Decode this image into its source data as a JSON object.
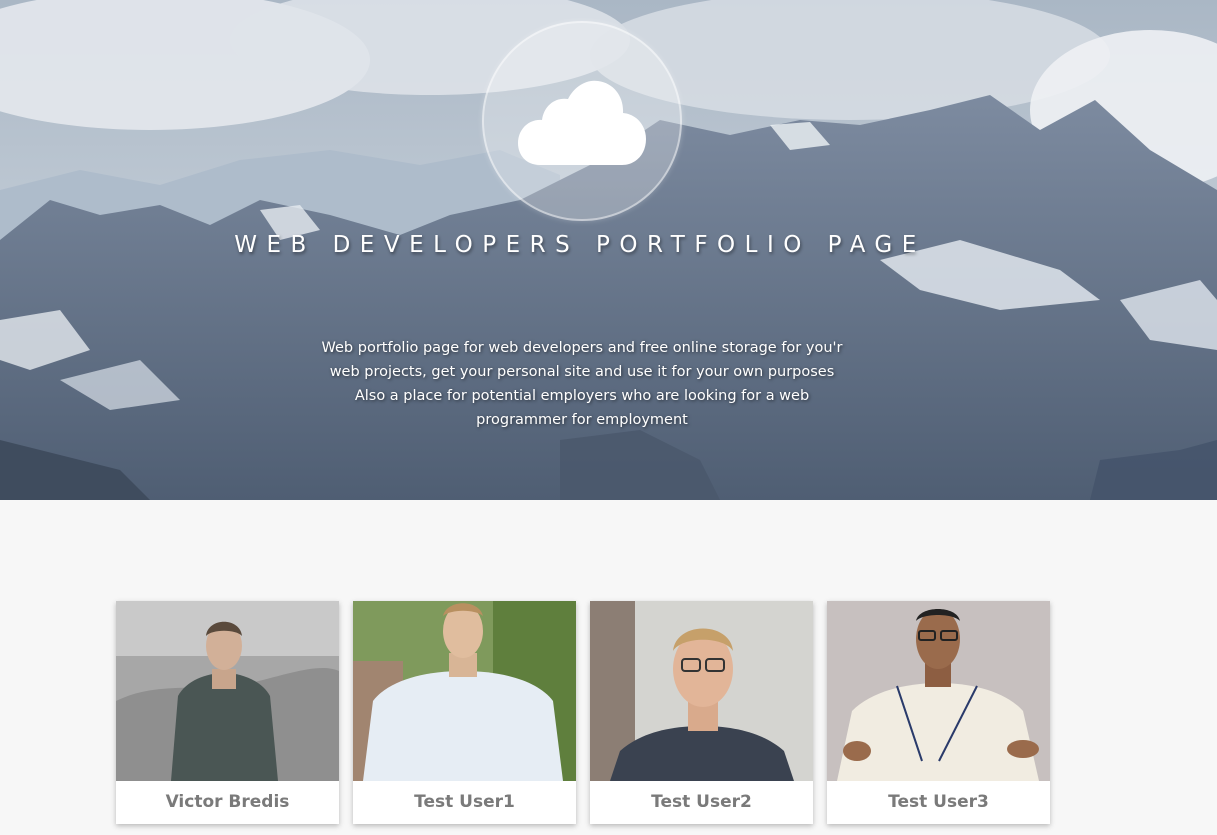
{
  "hero": {
    "logo_icon": "cloud-icon",
    "title": "WEB DEVELOPERS PORTFOLIO PAGE",
    "description_lines": [
      "Web portfolio page for web developers and free online storage for you'r",
      "web projects, get your personal site and use it for your own purposes",
      "Also a place for potential employers who are looking for a web",
      "programmer for employment"
    ]
  },
  "users": [
    {
      "name": "Victor Bredis"
    },
    {
      "name": "Test User1"
    },
    {
      "name": "Test User2"
    },
    {
      "name": "Test User3"
    }
  ],
  "colors": {
    "page_bg": "#f7f7f7",
    "card_name": "#7a7a7a",
    "hero_text": "#ffffff"
  }
}
